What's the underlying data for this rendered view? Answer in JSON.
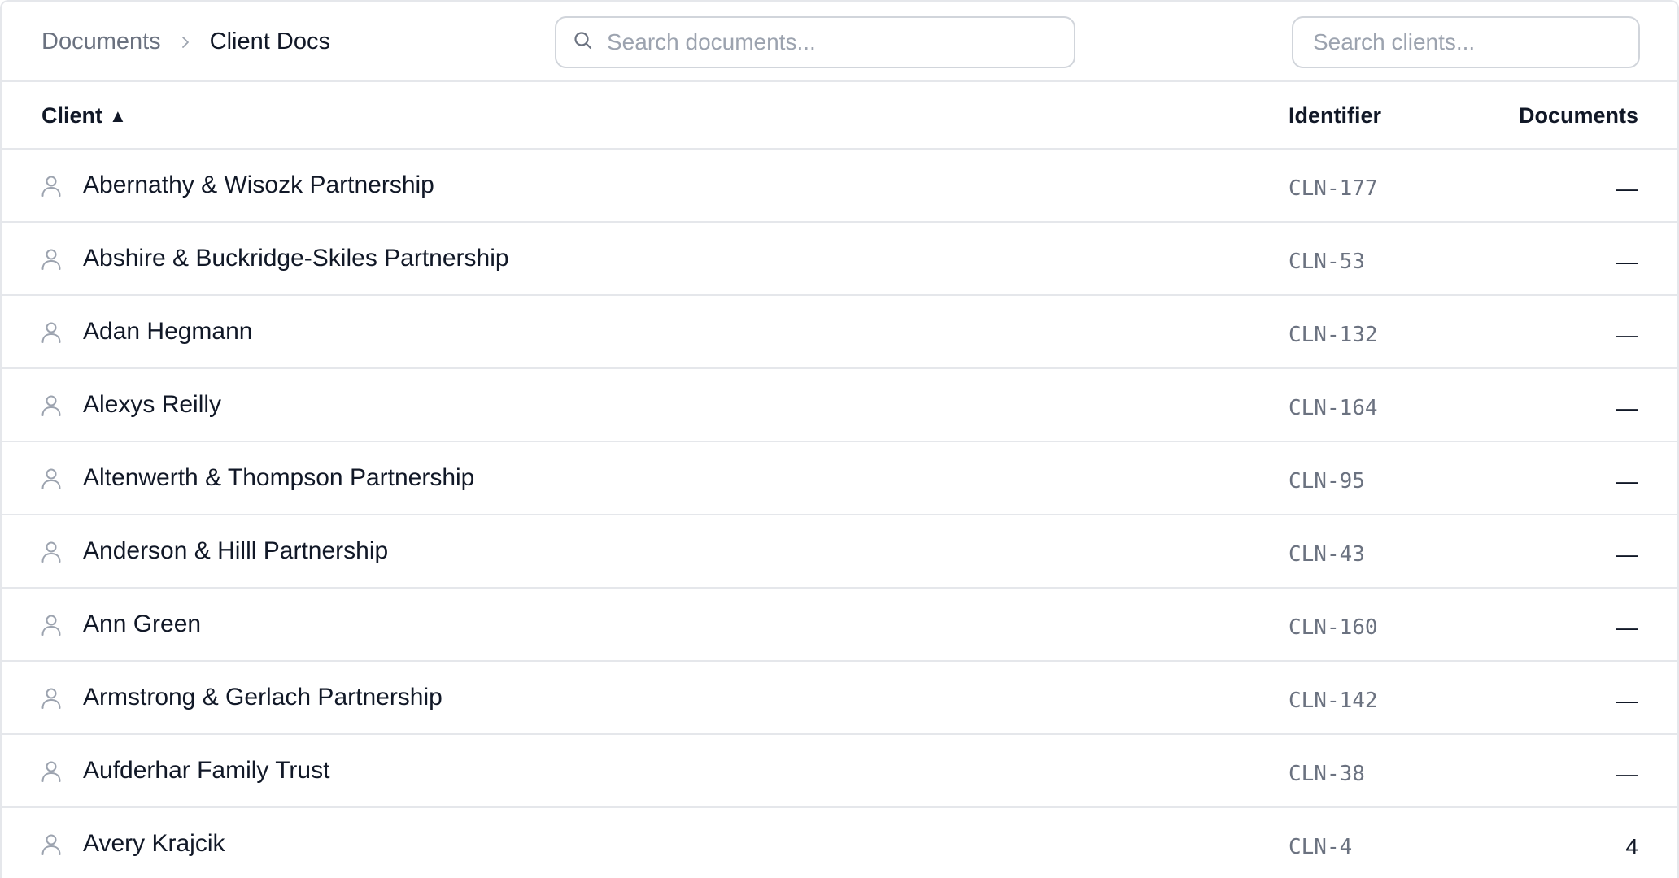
{
  "header": {
    "breadcrumb": {
      "root": "Documents",
      "current": "Client Docs"
    },
    "document_search": {
      "placeholder": "Search documents..."
    },
    "client_search": {
      "placeholder": "Search clients..."
    }
  },
  "table": {
    "columns": {
      "client": "Client",
      "sort_indicator": "▲",
      "identifier": "Identifier",
      "documents": "Documents"
    },
    "rows": [
      {
        "name": "Abernathy & Wisozk Partnership",
        "identifier": "CLN-177",
        "documents": "—"
      },
      {
        "name": "Abshire & Buckridge-Skiles Partnership",
        "identifier": "CLN-53",
        "documents": "—"
      },
      {
        "name": "Adan Hegmann",
        "identifier": "CLN-132",
        "documents": "—"
      },
      {
        "name": "Alexys Reilly",
        "identifier": "CLN-164",
        "documents": "—"
      },
      {
        "name": "Altenwerth & Thompson Partnership",
        "identifier": "CLN-95",
        "documents": "—"
      },
      {
        "name": "Anderson & Hilll Partnership",
        "identifier": "CLN-43",
        "documents": "—"
      },
      {
        "name": "Ann Green",
        "identifier": "CLN-160",
        "documents": "—"
      },
      {
        "name": "Armstrong & Gerlach Partnership",
        "identifier": "CLN-142",
        "documents": "—"
      },
      {
        "name": "Aufderhar Family Trust",
        "identifier": "CLN-38",
        "documents": "—"
      },
      {
        "name": "Avery Krajcik",
        "identifier": "CLN-4",
        "documents": "4"
      }
    ]
  },
  "icons": {
    "search": "search-icon",
    "breadcrumb_separator": "chevron-right-icon",
    "row_avatar": "user-icon"
  },
  "colors": {
    "border": "#e5e7eb",
    "muted_text": "#6b7280",
    "placeholder": "#9ca3af",
    "text": "#111827"
  }
}
